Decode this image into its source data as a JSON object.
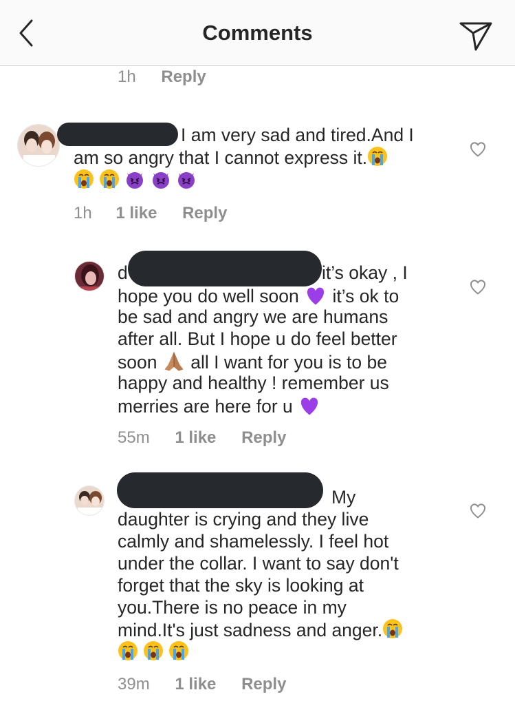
{
  "header": {
    "title": "Comments",
    "back_icon": "chevron-left-icon",
    "share_icon": "paper-plane-icon"
  },
  "top_meta": {
    "time": "1h",
    "reply": "Reply"
  },
  "comments": [
    {
      "text_line1": "I am very sad and tired.And I",
      "text_line2": "am so angry that I cannot express it.",
      "time": "1h",
      "likes": "1 like",
      "reply": "Reply"
    },
    {
      "username_visible": "d",
      "line1": "it’s okay , I",
      "line2a": "hope you do well soon",
      "line2b": "it’s ok to",
      "line3": "be sad and angry we are humans",
      "line4": "after all. But I hope u do feel better",
      "line5a": "soon",
      "line5b": "all I want for you is to be",
      "line6": "happy and healthy ! remember us",
      "line7": "merries are here for u",
      "time": "55m",
      "likes": "1 like",
      "reply": "Reply"
    },
    {
      "line1": "My",
      "line2": "daughter is crying and they live",
      "line3": "calmly and shamelessly. I feel hot",
      "line4": "under the collar. I want to say don't",
      "line5": "forget that the sky is looking at",
      "line6": "you.There is no peace in my",
      "line7": "mind.It's just sadness and anger.",
      "time": "39m",
      "likes": "1 like",
      "reply": "Reply"
    }
  ],
  "colors": {
    "text": "#262626",
    "meta": "#8e8e8e",
    "redaction": "#262a2e",
    "purple_heart": "#9b3ee8",
    "emoji_yellow": "#fbc02d"
  }
}
